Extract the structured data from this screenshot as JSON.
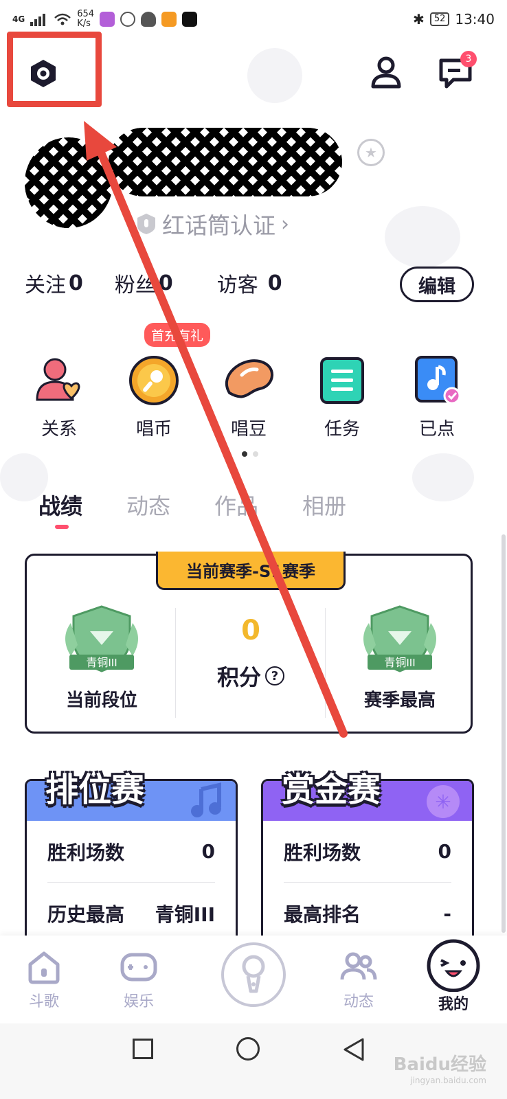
{
  "status_bar": {
    "network": "4G",
    "speed_value": "654",
    "speed_unit": "K/s",
    "battery": "52",
    "time": "13:40"
  },
  "top_bar": {
    "message_badge": "3",
    "icons": [
      "settings-hex-icon",
      "profile-icon",
      "message-icon"
    ]
  },
  "profile": {
    "verify_label": "红话筒认证"
  },
  "stats": {
    "follow_label": "关注",
    "follow_count": "0",
    "fans_label": "粉丝",
    "fans_count": "0",
    "visitor_label": "访客",
    "visitor_count": "0",
    "edit_label": "编辑"
  },
  "quick_actions": {
    "gift_tag": "首充有礼",
    "items": [
      {
        "label": "关系",
        "icon": "relation-icon"
      },
      {
        "label": "唱币",
        "icon": "sing-coin-icon"
      },
      {
        "label": "唱豆",
        "icon": "sing-bean-icon"
      },
      {
        "label": "任务",
        "icon": "task-icon"
      },
      {
        "label": "已点",
        "icon": "ordered-songs-icon"
      }
    ]
  },
  "tabs": [
    "战绩",
    "动态",
    "作品",
    "相册"
  ],
  "season": {
    "tag": "当前赛季-S1赛季",
    "current_rank_badge": "青铜III",
    "current_rank_label": "当前段位",
    "score": "0",
    "score_label": "积分",
    "help_mark": "?",
    "season_best_badge": "青铜III",
    "season_best_label": "赛季最高"
  },
  "ranked": {
    "title": "排位赛",
    "wins_label": "胜利场数",
    "wins_value": "0",
    "best_label": "历史最高",
    "best_value": "青铜III"
  },
  "bounty": {
    "title": "赏金赛",
    "wins_label": "胜利场数",
    "wins_value": "0",
    "best_label": "最高排名",
    "best_value": "-"
  },
  "bottom_nav": {
    "items": [
      "斗歌",
      "娱乐",
      "动态",
      "我的"
    ]
  },
  "watermark": {
    "text": "Baidu经验",
    "sub": "jingyan.baidu.com"
  },
  "colors": {
    "accent_red": "#ff4f6e",
    "annotation_red": "#e8483d",
    "gold": "#fbb731",
    "ranked_blue": "#6e93f5",
    "bounty_purple": "#8f63f3"
  }
}
